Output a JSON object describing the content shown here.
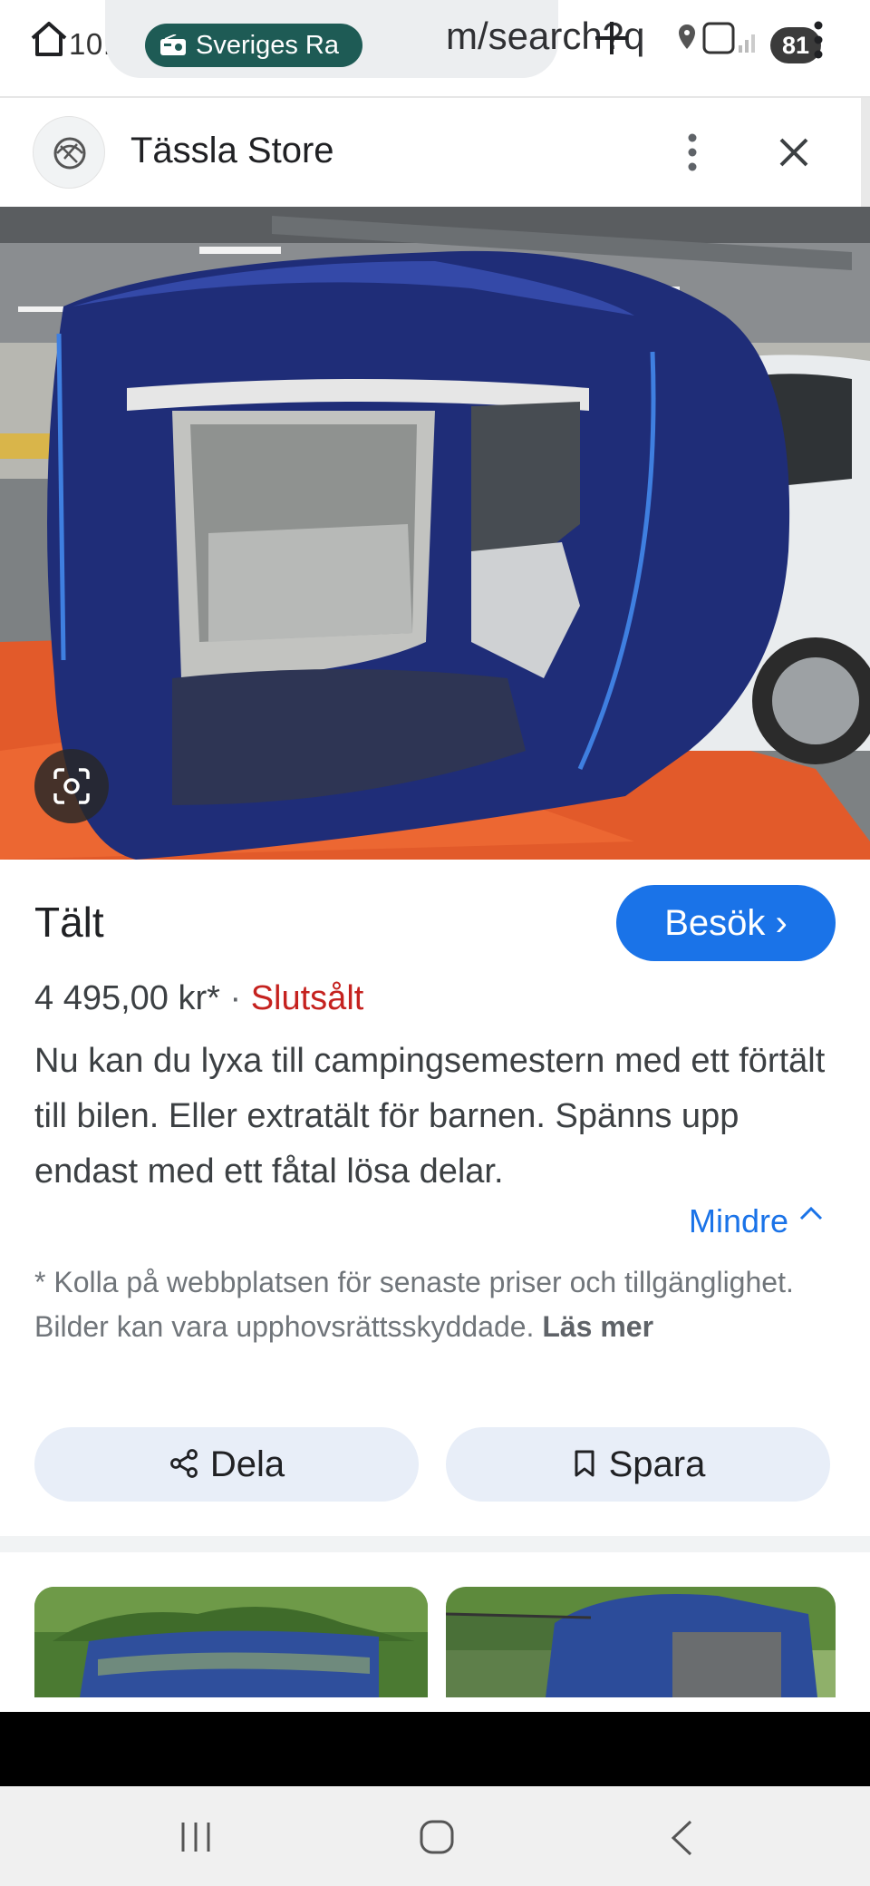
{
  "browser": {
    "time": "10:05",
    "url_fragment": "m/search?q",
    "radio_chip_label": "Sveriges Ra",
    "battery": "81"
  },
  "store": {
    "name": "Tässla Store"
  },
  "product": {
    "title": "Tält",
    "visit_label": "Besök ›",
    "price": "4 495,00 kr*",
    "separator": "·",
    "availability": "Slutsålt",
    "description": "Nu kan du lyxa till campingsemestern med ett förtält till bilen. Eller extratält för barnen. Spänns upp endast med ett fåtal lösa delar.",
    "less_label": "Mindre",
    "disclaimer": "* Kolla på webbplatsen för senaste priser och tillgänglighet. Bilder kan vara upphovsrättsskyddade.",
    "read_more": "Läs mer"
  },
  "actions": {
    "share_label": "Dela",
    "save_label": "Spara"
  },
  "colors": {
    "accent": "#1a73e8",
    "sold_out": "#c5221f",
    "action_bg": "#e8eef8",
    "chip_bg": "#1e5b55"
  }
}
